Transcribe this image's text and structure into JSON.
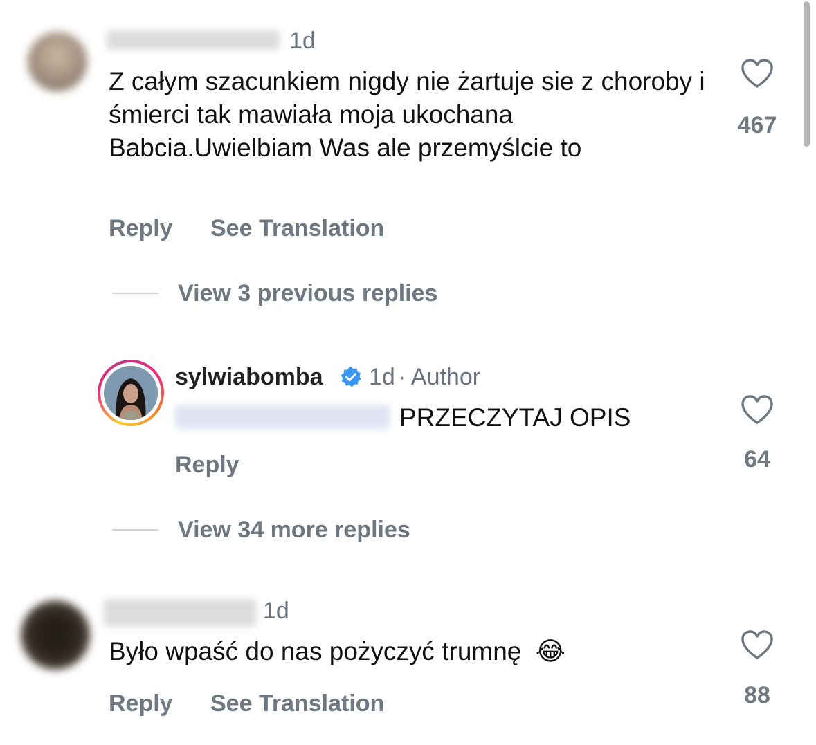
{
  "comments": [
    {
      "time": "1d",
      "text": "Z całym szacunkiem nigdy nie żartuje sie z choroby i śmierci  tak mawiała moja ukochana Babcia.Uwielbiam Was ale przemyślcie to",
      "likes": "467",
      "reply_label": "Reply",
      "translate_label": "See Translation"
    },
    {
      "username": "sylwiabomba",
      "verified": true,
      "time": "1d",
      "author_label": "· Author",
      "text": "PRZECZYTAJ OPIS",
      "likes": "64",
      "reply_label": "Reply"
    },
    {
      "time": "1d",
      "text": "Było wpaść do nas pożyczyć trumnę",
      "emoji": "😂",
      "likes": "88",
      "reply_label": "Reply",
      "translate_label": "See Translation"
    }
  ],
  "threads": {
    "previous_replies_label": "View 3 previous replies",
    "more_replies_label": "View 34 more replies"
  },
  "colors": {
    "text": "#111111",
    "secondary": "#6f7780",
    "verified": "#3897f0"
  },
  "icons": {
    "like": "heart-outline-icon",
    "verified": "verified-badge-icon"
  }
}
